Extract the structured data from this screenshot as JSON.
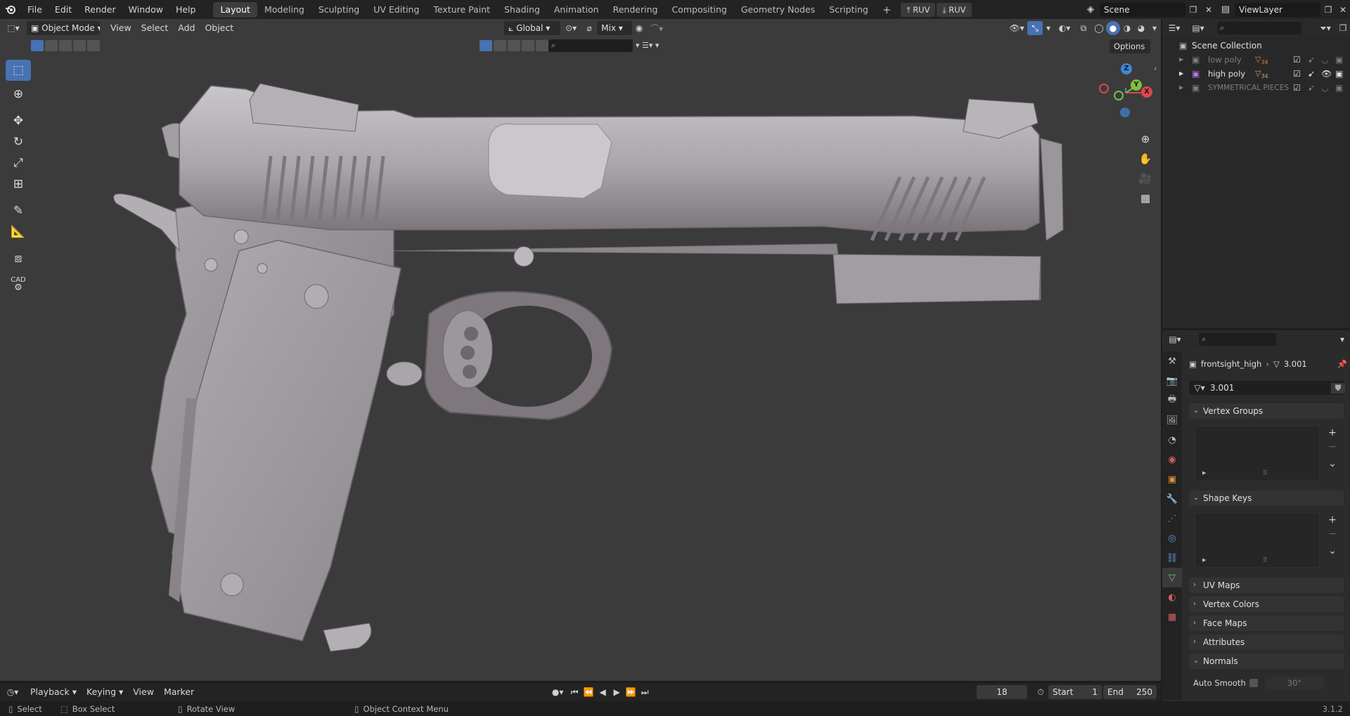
{
  "topbar": {
    "menus": [
      "File",
      "Edit",
      "Render",
      "Window",
      "Help"
    ],
    "workspaces": [
      "Layout",
      "Modeling",
      "Sculpting",
      "UV Editing",
      "Texture Paint",
      "Shading",
      "Animation",
      "Rendering",
      "Compositing",
      "Geometry Nodes",
      "Scripting"
    ],
    "active_workspace": "Layout",
    "add_tab": "+",
    "ruv_export": "RUV",
    "ruv_import": "RUV",
    "scene": "Scene",
    "view_layer": "ViewLayer"
  },
  "viewport_header": {
    "mode": "Object Mode",
    "menus": [
      "View",
      "Select",
      "Add",
      "Object"
    ],
    "transform_orientation": "Global",
    "snap_mode": "Mix",
    "options": "Options"
  },
  "toolbar": {
    "tools": [
      "select-box",
      "cursor",
      "move",
      "rotate",
      "scale",
      "transform",
      "annotate",
      "measure",
      "add-cube",
      "cad"
    ],
    "active_tool": "select-box",
    "cad_label": "CAD"
  },
  "gizmo": {
    "z": "Z",
    "y": "Y",
    "x": "X"
  },
  "outliner": {
    "root": "Scene Collection",
    "collections": [
      {
        "name": "low poly",
        "badge": "34",
        "enabled": false
      },
      {
        "name": "high poly",
        "badge": "34",
        "enabled": true
      },
      {
        "name": "SYMMETRICAL PIECES",
        "badge": "",
        "enabled": false
      }
    ]
  },
  "properties": {
    "object_name": "frontsight_high",
    "mesh_name": "3.001",
    "datablock": "3.001",
    "panels": {
      "vertex_groups": "Vertex Groups",
      "shape_keys": "Shape Keys",
      "uv_maps": "UV Maps",
      "vertex_colors": "Vertex Colors",
      "face_maps": "Face Maps",
      "attributes": "Attributes",
      "normals": "Normals"
    },
    "auto_smooth_label": "Auto Smooth",
    "auto_smooth_angle": "30°"
  },
  "timeline": {
    "menus": [
      "Playback",
      "Keying",
      "View",
      "Marker"
    ],
    "current_frame": "18",
    "start_label": "Start",
    "start_value": "1",
    "end_label": "End",
    "end_value": "250"
  },
  "statusbar": {
    "select": "Select",
    "box_select": "Box Select",
    "rotate_view": "Rotate View",
    "context_menu": "Object Context Menu",
    "version": "3.1.2"
  },
  "colors": {
    "accent": "#4772b3",
    "viewport_bg": "#3b3b3b",
    "x_axis": "#e0444e",
    "y_axis": "#7fbf3f",
    "z_axis": "#3f86d8"
  }
}
